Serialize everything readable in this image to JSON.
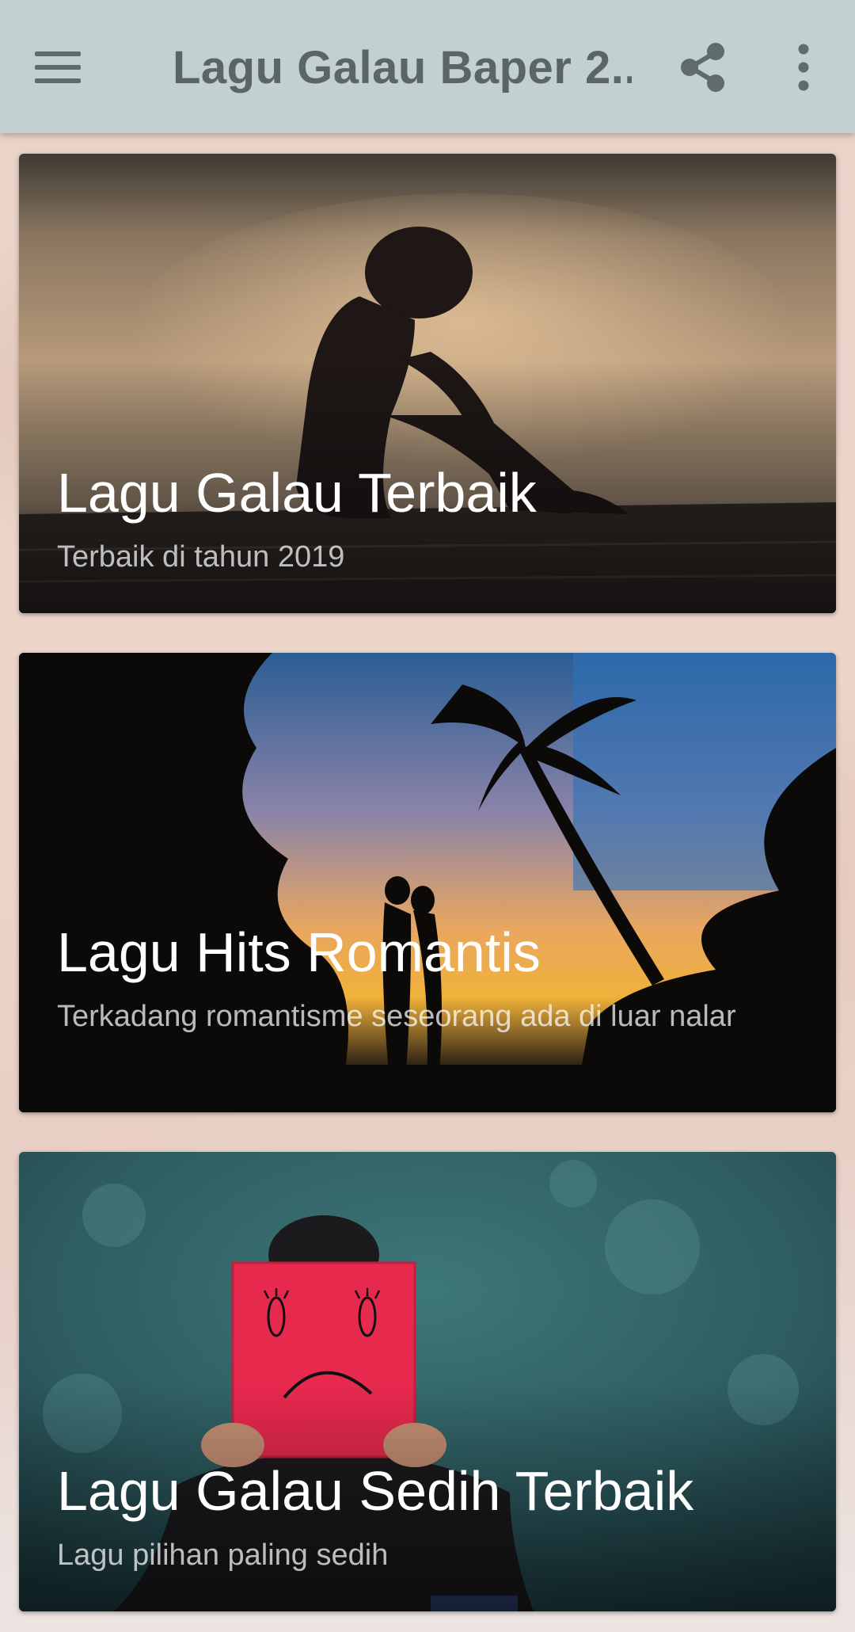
{
  "app_bar": {
    "title": "Lagu Galau Baper 2...",
    "menu_icon": "hamburger-menu-icon",
    "share_icon": "share-icon",
    "more_icon": "more-vert-icon",
    "background": "#c2d1cf"
  },
  "cards": [
    {
      "title": "Lagu Galau Terbaik",
      "subtitle": "Terbaik di tahun 2019"
    },
    {
      "title": "Lagu Hits Romantis",
      "subtitle": "Terkadang romantisme seseorang ada di luar nalar"
    },
    {
      "title": "Lagu Galau Sedih Terbaik",
      "subtitle": "Lagu pilihan paling sedih"
    }
  ]
}
